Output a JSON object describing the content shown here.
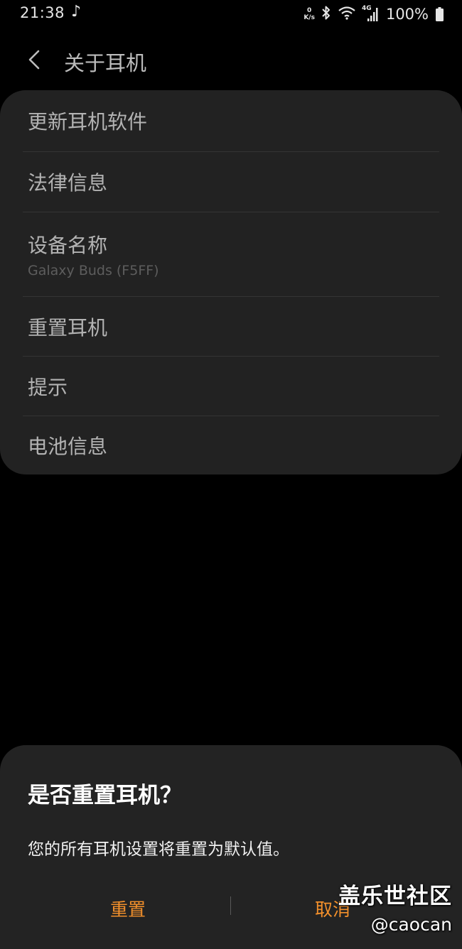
{
  "status_bar": {
    "time": "21:38",
    "net_speed_value": "0",
    "net_speed_unit": "K/s",
    "network_type": "4G",
    "battery": "100%"
  },
  "header": {
    "title": "关于耳机"
  },
  "settings": {
    "items": [
      {
        "label": "更新耳机软件"
      },
      {
        "label": "法律信息"
      },
      {
        "label": "设备名称",
        "sub": "Galaxy Buds (F5FF)"
      },
      {
        "label": "重置耳机"
      },
      {
        "label": "提示"
      },
      {
        "label": "电池信息"
      }
    ]
  },
  "dialog": {
    "title": "是否重置耳机？",
    "message": "您的所有耳机设置将重置为默认值。",
    "confirm_label": "重置",
    "cancel_label": "取消"
  },
  "watermark": {
    "title": "盖乐世社区",
    "handle": "@caocan"
  },
  "colors": {
    "accent": "#f3902b",
    "card_bg": "#222222",
    "dialog_bg": "#232323",
    "background": "#000000"
  }
}
